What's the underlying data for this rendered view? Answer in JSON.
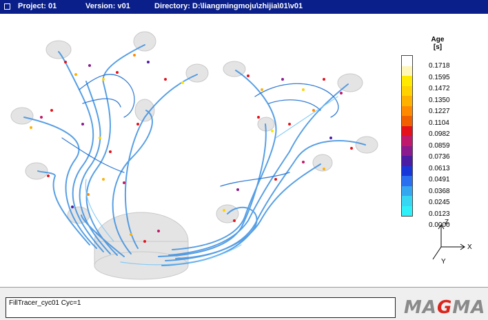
{
  "titlebar": {
    "project": "Project: 01",
    "version": "Version: v01",
    "directory": "Directory: D:\\liangmingmoju\\zhijia\\01\\v01"
  },
  "legend": {
    "title": "Age",
    "unit": "[s]",
    "values": [
      "0.1718",
      "0.1595",
      "0.1472",
      "0.1350",
      "0.1227",
      "0.1104",
      "0.0982",
      "0.0859",
      "0.0736",
      "0.0613",
      "0.0491",
      "0.0368",
      "0.0245",
      "0.0123",
      "0.0000"
    ],
    "colors": [
      "#ffffff",
      "#fff7b8",
      "#ffe900",
      "#ffd200",
      "#ffb100",
      "#ff8a00",
      "#f06000",
      "#e4111a",
      "#c0186a",
      "#8a1a8e",
      "#4b1da3",
      "#1837d8",
      "#2a6ff0",
      "#35a6f0",
      "#37d6f2",
      "#2ff0f8"
    ]
  },
  "axes": {
    "z": "Z",
    "x": "X",
    "y": "Y"
  },
  "statusbar": {
    "text": "FillTracer_cyc01 Cyc=1"
  },
  "logo": {
    "pre": "MA",
    "mid": "G",
    "post": "MA"
  }
}
